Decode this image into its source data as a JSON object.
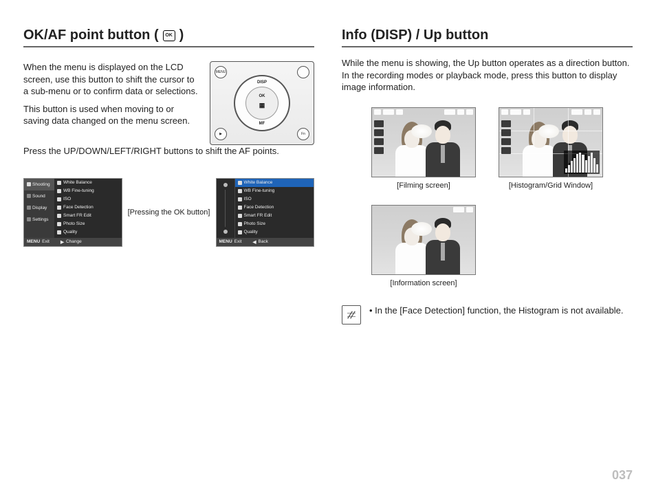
{
  "page_number": "037",
  "left": {
    "heading_a": "OK/AF point button (",
    "heading_b": ")",
    "ok_icon_label": "OK",
    "para1": "When the menu is displayed on the LCD screen, use this button to shift the cursor to a sub-menu or to confirm data or selections.",
    "para2": "This button is used when moving to or saving data changed on the menu screen.",
    "para3": "Press the UP/DOWN/LEFT/RIGHT buttons to shift the AF points.",
    "controls": {
      "top": "DISP",
      "center_top": "OK",
      "bottom": "MF",
      "btn_tl": "MENU",
      "btn_bl": "▶",
      "btn_br": "Fn",
      "btn_tr": ""
    },
    "menu1": {
      "left_items": [
        "Shooting",
        "Sound",
        "Display",
        "Settings"
      ],
      "right_items": [
        "White Balance",
        "WB Fine-tuning",
        "ISO",
        "Face Detection",
        "Smart FR Edit",
        "Photo Size",
        "Quality"
      ],
      "foot_left_key": "MENU",
      "foot_left": "Exit",
      "foot_right_key": "▶",
      "foot_right": "Change"
    },
    "press_label": "[Pressing the OK button]",
    "menu2": {
      "right_items": [
        "White Balance",
        "WB Fine-tuning",
        "ISO",
        "Face Detection",
        "Smart FR Edit",
        "Photo Size",
        "Quality"
      ],
      "foot_left_key": "MENU",
      "foot_left": "Exit",
      "foot_right_key": "◀",
      "foot_right": "Back"
    }
  },
  "right": {
    "heading": "Info (DISP) / Up button",
    "para": "While the menu is showing, the Up button operates as a direction button. In the recording modes or playback mode, press this button to display image information.",
    "captions": {
      "filming": "[Filming screen]",
      "histo": "[Histogram/Grid Window]",
      "info": "[Information screen]"
    },
    "note": "In the [Face Detection] function, the Histogram is not available."
  }
}
